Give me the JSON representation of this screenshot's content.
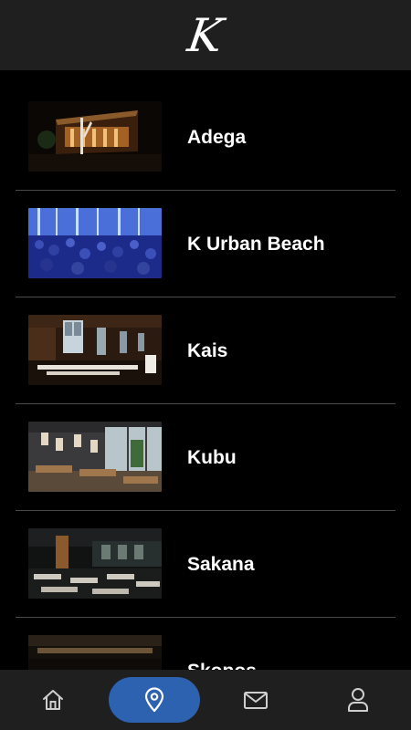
{
  "header": {
    "logo_text": "K",
    "logo_icon": "k-script-logo"
  },
  "venues": [
    {
      "name": "Adega"
    },
    {
      "name": "K Urban Beach"
    },
    {
      "name": "Kais"
    },
    {
      "name": "Kubu"
    },
    {
      "name": "Sakana"
    },
    {
      "name": "Skopos"
    }
  ],
  "nav": {
    "items": [
      {
        "icon": "home-icon"
      },
      {
        "icon": "location-pin-icon",
        "active": true
      },
      {
        "icon": "mail-icon"
      },
      {
        "icon": "user-icon"
      }
    ],
    "accent": "#2d62b0"
  }
}
